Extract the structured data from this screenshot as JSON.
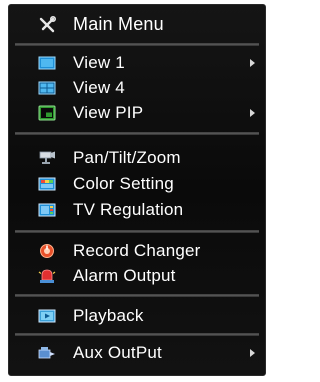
{
  "menu": {
    "title": "Main Menu",
    "title_icon": "tools-icon",
    "items": [
      {
        "label": "View 1",
        "icon": "single-view-icon",
        "submenu": true
      },
      {
        "label": "View 4",
        "icon": "quad-view-icon",
        "submenu": false
      },
      {
        "label": "View PIP",
        "icon": "pip-icon",
        "submenu": true
      },
      {
        "label": "Pan/Tilt/Zoom",
        "icon": "ptz-camera-icon",
        "submenu": false
      },
      {
        "label": "Color Setting",
        "icon": "color-setting-icon",
        "submenu": false
      },
      {
        "label": "TV Regulation",
        "icon": "tv-regulation-icon",
        "submenu": false
      },
      {
        "label": "Record Changer",
        "icon": "record-icon",
        "submenu": false
      },
      {
        "label": "Alarm Output",
        "icon": "alarm-icon",
        "submenu": false
      },
      {
        "label": "Playback",
        "icon": "playback-icon",
        "submenu": false
      },
      {
        "label": "Aux OutPut",
        "icon": "aux-output-icon",
        "submenu": true
      }
    ]
  },
  "colors": {
    "background": "#0a0a0a",
    "text": "#ffffff",
    "separator": "#555555"
  }
}
